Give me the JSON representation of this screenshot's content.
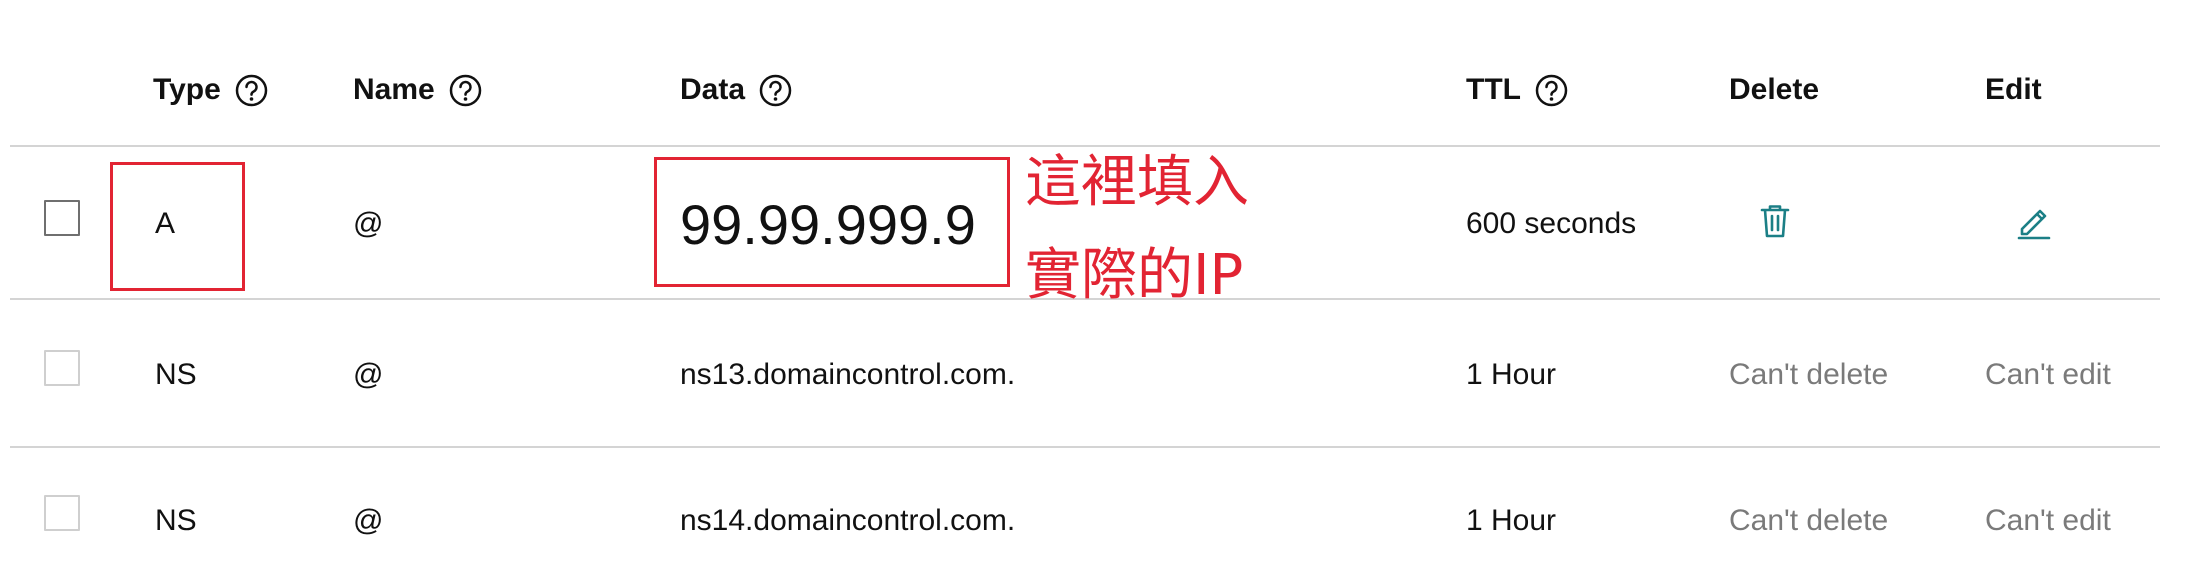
{
  "headers": {
    "type": "Type",
    "name": "Name",
    "data": "Data",
    "ttl": "TTL",
    "delete": "Delete",
    "edit": "Edit"
  },
  "records": [
    {
      "type": "A",
      "name": "@",
      "data": "99.99.999.9",
      "ttl": "600 seconds",
      "delete_icon": "trash-icon",
      "edit_icon": "pencil-icon"
    },
    {
      "type": "NS",
      "name": "@",
      "data": "ns13.domaincontrol.com.",
      "ttl": "1 Hour",
      "delete": "Can't delete",
      "edit": "Can't edit"
    },
    {
      "type": "NS",
      "name": "@",
      "data": "ns14.domaincontrol.com.",
      "ttl": "1 Hour",
      "delete": "Can't delete",
      "edit": "Can't edit"
    }
  ],
  "annotation": {
    "line1": "這裡填入",
    "line2": "實際的IP",
    "color": "#e22433"
  },
  "colors": {
    "text": "#111111",
    "muted": "#7a7a7a",
    "divider": "#d4d4d4",
    "icon_teal": "#1b7f86",
    "annotation_red": "#e22433"
  }
}
